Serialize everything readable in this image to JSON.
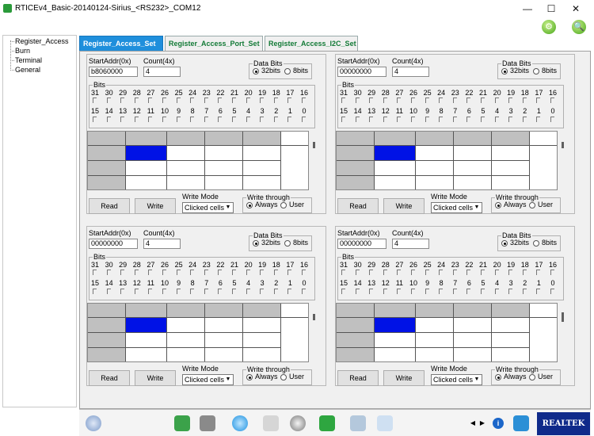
{
  "window": {
    "title": "RTICEv4_Basic-20140124-Sirius_<RS232>_COM12",
    "min_glyph": "—",
    "max_glyph": "☐",
    "close_glyph": "✕"
  },
  "toolbar": {
    "gear_glyph": "⚙",
    "search_glyph": "🔍"
  },
  "tree": {
    "items": [
      "Register_Access",
      "Burn",
      "Terminal",
      "General"
    ]
  },
  "tabs": [
    "Register_Access_Set",
    "Register_Access_Port_Set",
    "Register_Access_I2C_Set"
  ],
  "labels": {
    "start_addr": "StartAddr(0x)",
    "count": "Count(4x)",
    "data_bits": "Data Bits",
    "bits": "Bits",
    "write_mode": "Write Mode",
    "write_through": "Write through",
    "opt_32": "32bits",
    "opt_8": "8bits",
    "opt_always": "Always",
    "opt_user": "User",
    "read": "Read",
    "write": "Write",
    "select_value": "Clicked cells",
    "select_arrow": "▼"
  },
  "bits_top": [
    "31",
    "30",
    "29",
    "28",
    "27",
    "26",
    "25",
    "24",
    "23",
    "22",
    "21",
    "20",
    "19",
    "18",
    "17",
    "16"
  ],
  "bits_bottom": [
    "15",
    "14",
    "13",
    "12",
    "11",
    "10",
    "9",
    "8",
    "7",
    "6",
    "5",
    "4",
    "3",
    "2",
    "1",
    "0"
  ],
  "panels": [
    {
      "start_addr": "b8060000",
      "count": "4"
    },
    {
      "start_addr": "00000000",
      "count": "4"
    },
    {
      "start_addr": "00000000",
      "count": "4"
    },
    {
      "start_addr": "00000000",
      "count": "4"
    }
  ],
  "bottom": {
    "nav_left": "◀",
    "nav_right": "▶",
    "info_glyph": "i",
    "logo_text": "REALTEK"
  },
  "colors": {
    "tab_active": "#1f8fdc",
    "tab_text": "#127a36",
    "selected_cell": "#0012e6",
    "logo_bg": "#0f2a8a"
  }
}
